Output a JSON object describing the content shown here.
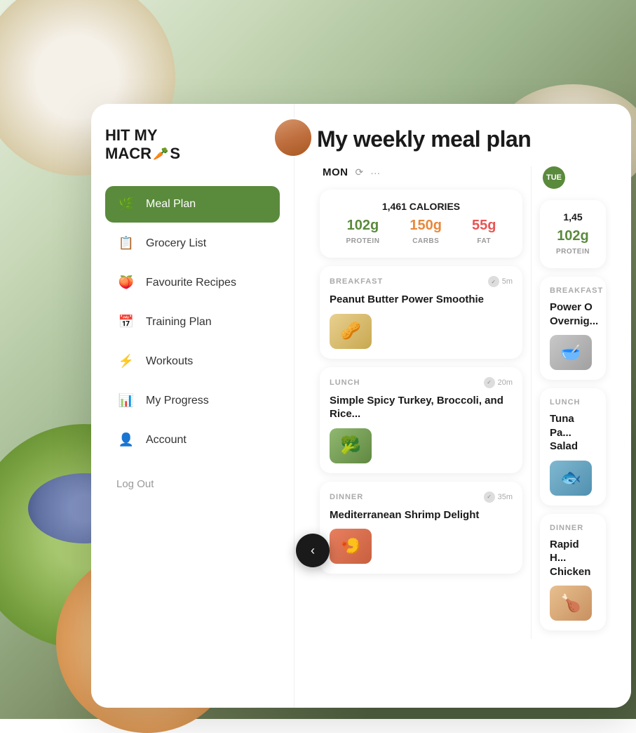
{
  "app": {
    "name_line1": "HIT MY",
    "name_line2": "MACR",
    "name_suffix": "S",
    "title": "My weekly meal plan"
  },
  "sidebar": {
    "nav_items": [
      {
        "id": "meal-plan",
        "label": "Meal Plan",
        "icon": "🌿",
        "active": true
      },
      {
        "id": "grocery-list",
        "label": "Grocery List",
        "icon": "📋",
        "active": false
      },
      {
        "id": "favourite-recipes",
        "label": "Favourite Recipes",
        "icon": "🍑",
        "active": false
      },
      {
        "id": "training-plan",
        "label": "Training Plan",
        "icon": "📅",
        "active": false
      },
      {
        "id": "workouts",
        "label": "Workouts",
        "icon": "⚡",
        "active": false
      },
      {
        "id": "my-progress",
        "label": "My Progress",
        "icon": "📊",
        "active": false
      },
      {
        "id": "account",
        "label": "Account",
        "icon": "👤",
        "active": false
      }
    ],
    "logout_label": "Log Out"
  },
  "days": [
    {
      "label": "MON",
      "calories": "1,461 CALORIES",
      "protein_value": "102g",
      "protein_label": "PROTEIN",
      "carbs_value": "150g",
      "carbs_label": "CARBS",
      "fat_value": "55g",
      "fat_label": "FAT",
      "meals": [
        {
          "type": "BREAKFAST",
          "time": "5m",
          "name": "Peanut Butter Power Smoothie",
          "thumb_class": "thumb-smoothie",
          "thumb_emoji": "🥜"
        },
        {
          "type": "LUNCH",
          "time": "20m",
          "name": "Simple Spicy Turkey, Broccoli, and Rice...",
          "thumb_class": "thumb-turkey",
          "thumb_emoji": "🥦"
        },
        {
          "type": "DINNER",
          "time": "35m",
          "name": "Mediterranean Shrimp Delight",
          "thumb_class": "thumb-shrimp",
          "thumb_emoji": "🍤"
        }
      ]
    },
    {
      "label": "TUE",
      "calories": "1,45",
      "protein_value": "102g",
      "protein_label": "PROTEIN",
      "meals": [
        {
          "type": "BREAKFAST",
          "name": "Power O Overnig...",
          "thumb_class": "thumb-overnight",
          "thumb_emoji": "🥣"
        },
        {
          "type": "LUNCH",
          "name": "Tuna Pa... Salad",
          "thumb_class": "thumb-tuna",
          "thumb_emoji": "🐟"
        },
        {
          "type": "DINNER",
          "name": "Rapid H... Chicken",
          "thumb_class": "thumb-chicken",
          "thumb_emoji": "🍗"
        }
      ]
    }
  ],
  "back_button_icon": "‹",
  "colors": {
    "primary_green": "#5a8a3c",
    "protein_color": "#5a8a3c",
    "carbs_color": "#e8883a",
    "fat_color": "#e85555",
    "text_dark": "#1a1a1a",
    "text_gray": "#aaaaaa"
  }
}
